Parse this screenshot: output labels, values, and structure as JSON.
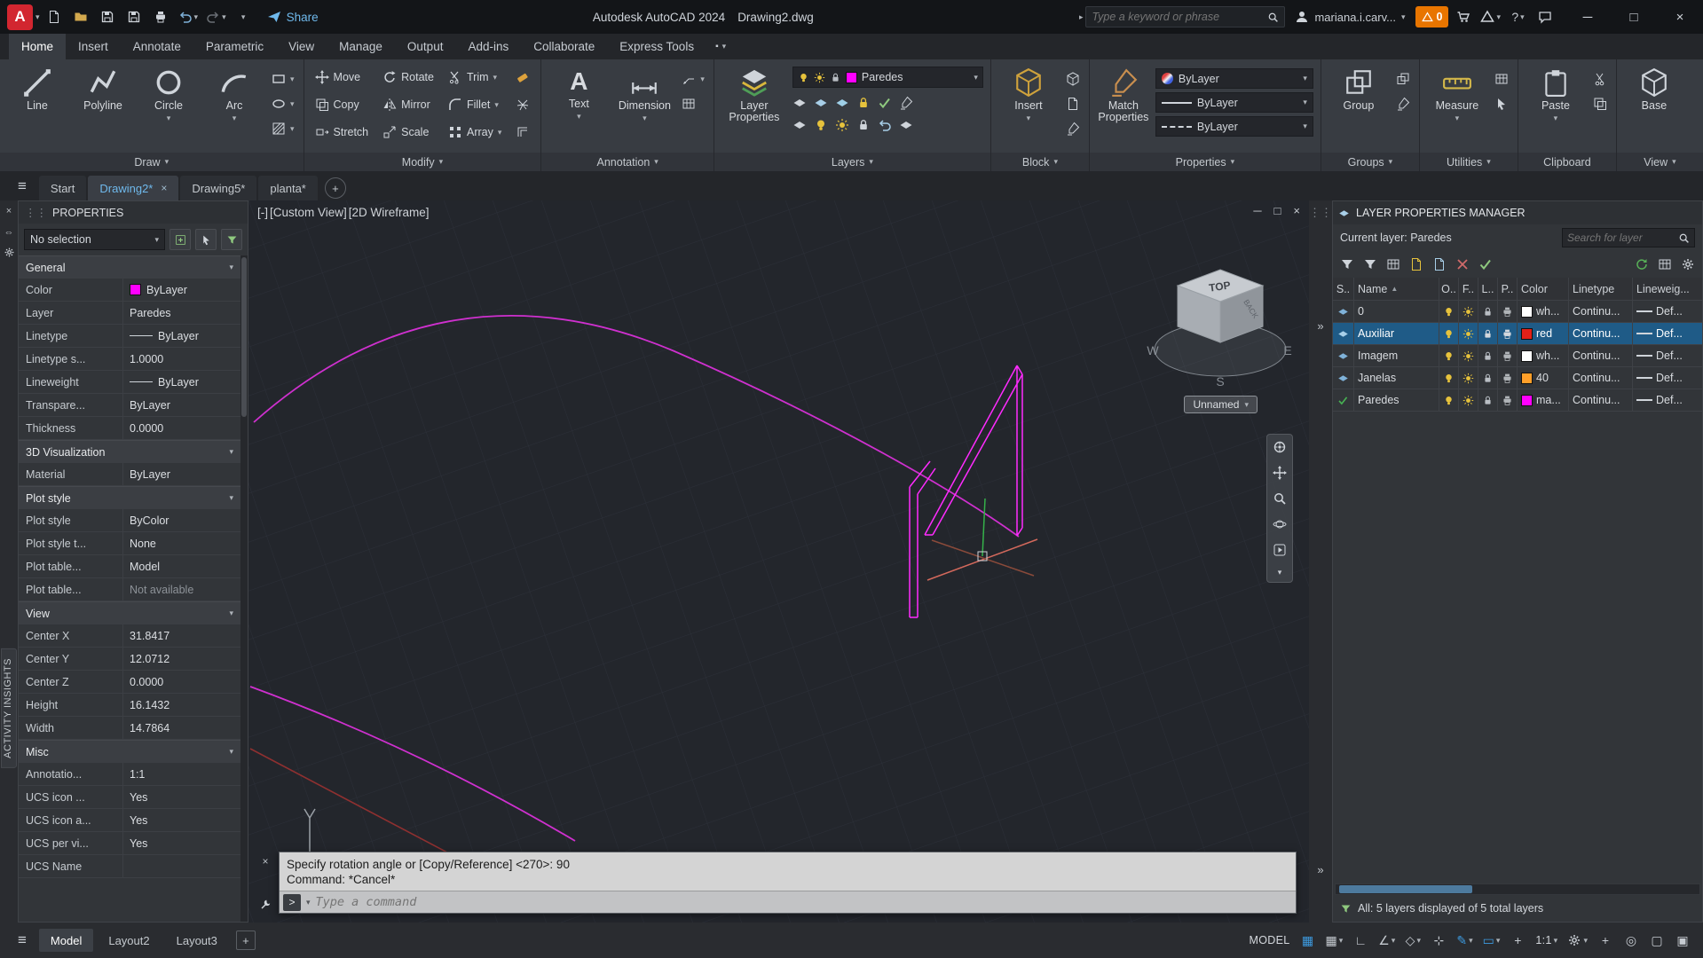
{
  "titlebar": {
    "share_label": "Share",
    "app_title": "Autodesk AutoCAD 2024",
    "doc_name": "Drawing2.dwg",
    "search_placeholder": "Type a keyword or phrase",
    "user_name": "mariana.i.carv...",
    "alert_badge": "0"
  },
  "ribbon": {
    "tabs": [
      {
        "label": "Home"
      },
      {
        "label": "Insert"
      },
      {
        "label": "Annotate"
      },
      {
        "label": "Parametric"
      },
      {
        "label": "View"
      },
      {
        "label": "Manage"
      },
      {
        "label": "Output"
      },
      {
        "label": "Add-ins"
      },
      {
        "label": "Collaborate"
      },
      {
        "label": "Express Tools"
      }
    ],
    "panels": {
      "draw": {
        "label": "Draw",
        "buttons": [
          "Line",
          "Polyline",
          "Circle",
          "Arc"
        ]
      },
      "modify": {
        "label": "Modify",
        "buttons": [
          "Move",
          "Rotate",
          "Trim",
          "Copy",
          "Mirror",
          "Fillet",
          "Stretch",
          "Scale",
          "Array"
        ]
      },
      "annotation": {
        "label": "Annotation",
        "buttons": [
          "Text",
          "Dimension"
        ]
      },
      "layers": {
        "label": "Layers",
        "main_button": "Layer Properties",
        "layer_select": "Paredes"
      },
      "properties": {
        "label": "Properties",
        "main_button": "Match Properties",
        "color_value": "ByLayer",
        "lineweight_value": "ByLayer",
        "linetype_value": "ByLayer"
      },
      "block": {
        "label": "Block",
        "main_button": "Insert"
      },
      "groups": {
        "label": "Groups",
        "main_button": "Group"
      },
      "utilities": {
        "label": "Utilities",
        "main_button": "Measure"
      },
      "clipboard": {
        "label": "Clipboard",
        "main_button": "Paste"
      },
      "view": {
        "label": "View",
        "main_button": "Base"
      }
    }
  },
  "file_tabs": {
    "items": [
      {
        "label": "Start"
      },
      {
        "label": "Drawing2*"
      },
      {
        "label": "Drawing5*"
      },
      {
        "label": "planta*"
      }
    ]
  },
  "properties_palette": {
    "title": "PROPERTIES",
    "selection_value": "No selection",
    "side_tab": "ACTIVITY INSIGHTS",
    "sections": {
      "general": {
        "header": "General",
        "rows": [
          {
            "label": "Color",
            "value": "ByLayer",
            "swatch": "#ff00ff"
          },
          {
            "label": "Layer",
            "value": "Paredes"
          },
          {
            "label": "Linetype",
            "value": "ByLayer"
          },
          {
            "label": "Linetype s...",
            "value": "1.0000"
          },
          {
            "label": "Lineweight",
            "value": "ByLayer"
          },
          {
            "label": "Transpare...",
            "value": "ByLayer"
          },
          {
            "label": "Thickness",
            "value": "0.0000"
          }
        ]
      },
      "vis3d": {
        "header": "3D Visualization",
        "rows": [
          {
            "label": "Material",
            "value": "ByLayer"
          }
        ]
      },
      "plot": {
        "header": "Plot style",
        "rows": [
          {
            "label": "Plot style",
            "value": "ByColor"
          },
          {
            "label": "Plot style t...",
            "value": "None"
          },
          {
            "label": "Plot table...",
            "value": "Model"
          },
          {
            "label": "Plot table...",
            "value": "Not available"
          }
        ]
      },
      "view": {
        "header": "View",
        "rows": [
          {
            "label": "Center X",
            "value": "31.8417"
          },
          {
            "label": "Center Y",
            "value": "12.0712"
          },
          {
            "label": "Center Z",
            "value": "0.0000"
          },
          {
            "label": "Height",
            "value": "16.1432"
          },
          {
            "label": "Width",
            "value": "14.7864"
          }
        ]
      },
      "misc": {
        "header": "Misc",
        "rows": [
          {
            "label": "Annotatio...",
            "value": "1:1"
          },
          {
            "label": "UCS icon ...",
            "value": "Yes"
          },
          {
            "label": "UCS icon a...",
            "value": "Yes"
          },
          {
            "label": "UCS per vi...",
            "value": "Yes"
          },
          {
            "label": "UCS Name",
            "value": ""
          }
        ]
      }
    }
  },
  "viewport": {
    "controls": "[-]",
    "view_name": "[Custom View]",
    "visual_style": "[2D Wireframe]",
    "unnamed_view": "Unnamed",
    "viewcube": {
      "top": "TOP",
      "back": "BACK",
      "w": "W",
      "s": "S",
      "e": "E"
    }
  },
  "layer_manager": {
    "title": "LAYER PROPERTIES MANAGER",
    "current_layer": "Current layer: Paredes",
    "search_placeholder": "Search for layer",
    "columns": [
      "S..",
      "Name",
      "O..",
      "F..",
      "L..",
      "P..",
      "Color",
      "Linetype",
      "Lineweig..."
    ],
    "rows": [
      {
        "name": "0",
        "color_name": "wh...",
        "color": "#ffffff",
        "linetype": "Continu...",
        "lineweight": "Def..."
      },
      {
        "name": "Auxiliar",
        "color_name": "red",
        "color": "#e32119",
        "linetype": "Continu...",
        "lineweight": "Def..."
      },
      {
        "name": "Imagem",
        "color_name": "wh...",
        "color": "#ffffff",
        "linetype": "Continu...",
        "lineweight": "Def..."
      },
      {
        "name": "Janelas",
        "color_name": "40",
        "color": "#ff9f29",
        "linetype": "Continu...",
        "lineweight": "Def..."
      },
      {
        "name": "Paredes",
        "color_name": "ma...",
        "color": "#ff00ff",
        "linetype": "Continu...",
        "lineweight": "Def..."
      }
    ],
    "status": "All: 5 layers displayed of 5 total layers"
  },
  "command_line": {
    "history": [
      "Specify rotation angle or [Copy/Reference] <270>: 90",
      "Command: *Cancel*"
    ],
    "prompt_placeholder": "Type a command"
  },
  "status_bar": {
    "layout_tabs": [
      "Model",
      "Layout2",
      "Layout3"
    ],
    "model_label": "MODEL",
    "annotation_scale": "1:1"
  },
  "colors": {
    "accent_blue": "#3d9be0",
    "selection_blue": "#1f5b87",
    "paredes_magenta": "#ff00ff",
    "auxiliar_red": "#e32119",
    "janelas_orange": "#ff9f29",
    "layer_white": "#ffffff",
    "warning_orange": "#e87500",
    "current_layer_green": "#47b353"
  }
}
